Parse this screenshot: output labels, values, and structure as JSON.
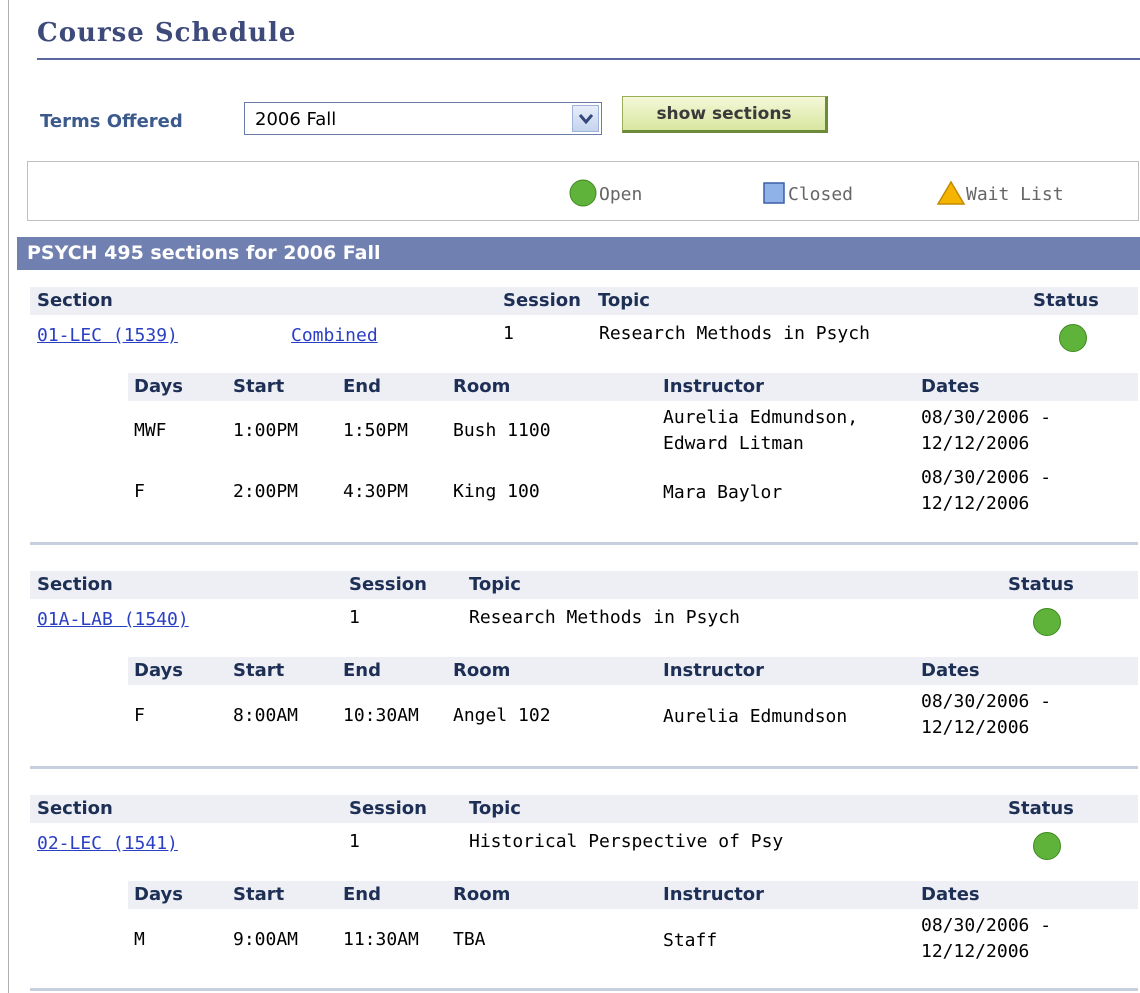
{
  "page": {
    "title": "Course Schedule"
  },
  "terms": {
    "label": "Terms Offered",
    "selected": "2006 Fall",
    "button": "show sections"
  },
  "legend": {
    "open": "Open",
    "closed": "Closed",
    "waitlist": "Wait List"
  },
  "header": "PSYCH 495 sections for 2006 Fall",
  "colors": {
    "header_bg": "#7080b0",
    "status_open": "#5fb33a",
    "link": "#2b3fc4"
  },
  "labels": {
    "section": "Section",
    "session": "Session",
    "topic": "Topic",
    "status": "Status",
    "days": "Days",
    "start": "Start",
    "end": "End",
    "room": "Room",
    "instructor": "Instructor",
    "dates": "Dates"
  },
  "sections": [
    {
      "section": "01-LEC (1539)",
      "combined": "Combined",
      "session": "1",
      "topic": "Research Methods in Psych",
      "status": "open-icon",
      "meetings": [
        {
          "days": "MWF",
          "start": "1:00PM",
          "end": "1:50PM",
          "room": "Bush 1100",
          "instructor_1": "Aurelia Edmundson,",
          "instructor_2": "Edward Litman",
          "date_1": "08/30/2006 -",
          "date_2": "12/12/2006"
        },
        {
          "days": "F",
          "start": "2:00PM",
          "end": "4:30PM",
          "room": "King 100",
          "instructor_1": "Mara Baylor",
          "instructor_2": "",
          "date_1": "08/30/2006 -",
          "date_2": "12/12/2006"
        }
      ]
    },
    {
      "section": "01A-LAB (1540)",
      "session": "1",
      "topic": "Research Methods in Psych",
      "status": "open-icon",
      "meetings": [
        {
          "days": "F",
          "start": "8:00AM",
          "end": "10:30AM",
          "room": "Angel 102",
          "instructor_1": "Aurelia Edmundson",
          "date_1": "08/30/2006 -",
          "date_2": "12/12/2006"
        }
      ]
    },
    {
      "section": "02-LEC (1541)",
      "session": "1",
      "topic": "Historical Perspective of Psy",
      "status": "open-icon",
      "meetings": [
        {
          "days": "M",
          "start": "9:00AM",
          "end": "11:30AM",
          "room": "TBA",
          "instructor_1": "Staff",
          "date_1": "08/30/2006 -",
          "date_2": "12/12/2006"
        }
      ]
    }
  ]
}
